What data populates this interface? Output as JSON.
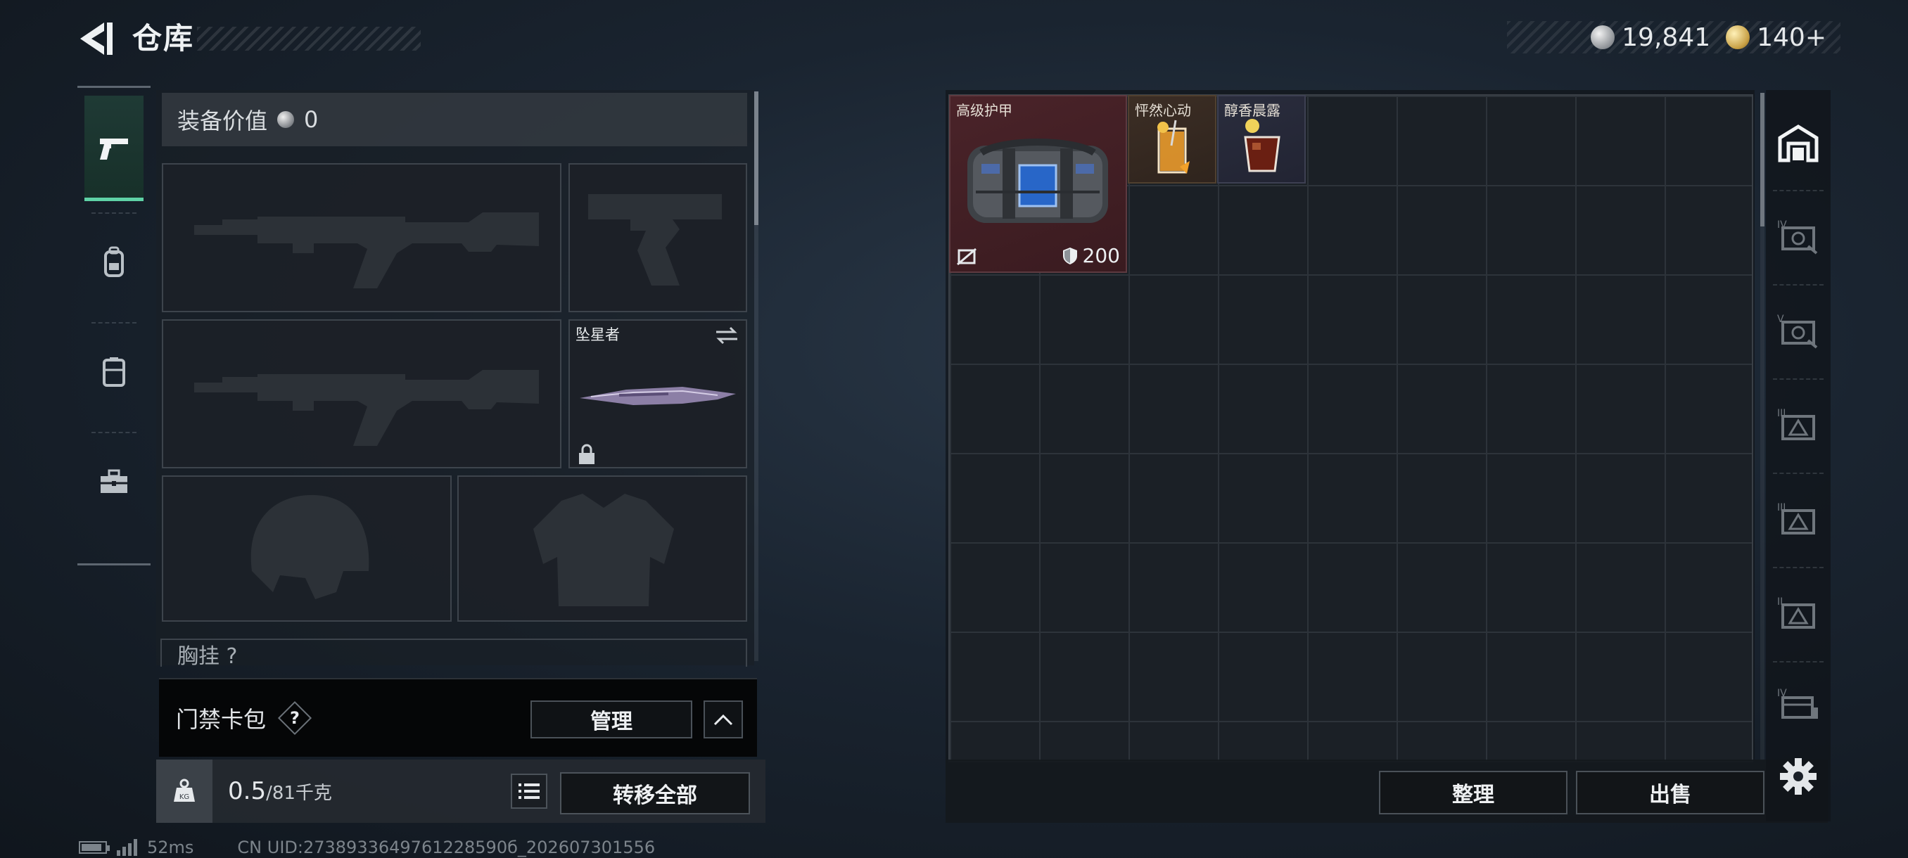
{
  "header": {
    "title": "仓库",
    "currencies": [
      {
        "type": "silver",
        "value": "19,841"
      },
      {
        "type": "gold",
        "value": "140+"
      }
    ]
  },
  "rail": {
    "items": [
      {
        "icon": "pistol-icon",
        "active": true
      },
      {
        "icon": "backpack-icon",
        "active": false
      },
      {
        "icon": "vest-icon",
        "active": false
      },
      {
        "icon": "toolbox-icon",
        "active": false
      }
    ]
  },
  "loadout": {
    "value_label": "装备价值",
    "value": "0",
    "melee_name": "坠星者",
    "chest_label": "胸挂 ?"
  },
  "keycard": {
    "label": "门禁卡包",
    "help": "?",
    "manage_label": "管理"
  },
  "weight": {
    "current": "0.5",
    "max": "/81",
    "unit": "千克",
    "transfer_all_label": "转移全部"
  },
  "status": {
    "ping": "52ms",
    "uid": "CN UID:2738933649761228590б_202607301556"
  },
  "storage": {
    "items": [
      {
        "name": "高级护甲",
        "durability": "200"
      },
      {
        "name": "怦然心动"
      },
      {
        "name": "醇香晨露"
      }
    ],
    "sort_label": "整理",
    "sell_label": "出售"
  },
  "colors": {
    "accent": "#5fd2a6",
    "armor_bg": "#4a2329",
    "panel_bg": "#1b2026"
  }
}
